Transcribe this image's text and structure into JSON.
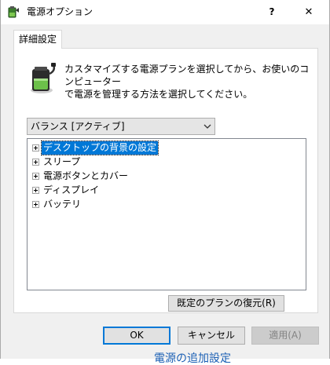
{
  "window": {
    "title": "電源オプション",
    "help_label": "?",
    "close_label": "✕"
  },
  "tab": {
    "label": "詳細設定"
  },
  "description": {
    "line1": "カスタマイズする電源プランを選択してから、お使いのコンピューター",
    "line2": "で電源を管理する方法を選択してください。"
  },
  "plan_dropdown": {
    "selected_value": "バランス [アクティブ]"
  },
  "tree": {
    "items": [
      {
        "label": "デスクトップの背景の設定",
        "selected": true
      },
      {
        "label": "スリープ",
        "selected": false
      },
      {
        "label": "電源ボタンとカバー",
        "selected": false
      },
      {
        "label": "ディスプレイ",
        "selected": false
      },
      {
        "label": "バッテリ",
        "selected": false
      }
    ]
  },
  "buttons": {
    "restore_defaults": "既定のプランの復元(R)",
    "ok": "OK",
    "cancel": "キャンセル",
    "apply": "適用(A)"
  },
  "background": {
    "partial_link": "電源の追加設定"
  },
  "colors": {
    "selection": "#0078d7",
    "window_bg": "#f0f0f0",
    "panel_bg": "#ffffff",
    "disabled_text": "#838383"
  }
}
